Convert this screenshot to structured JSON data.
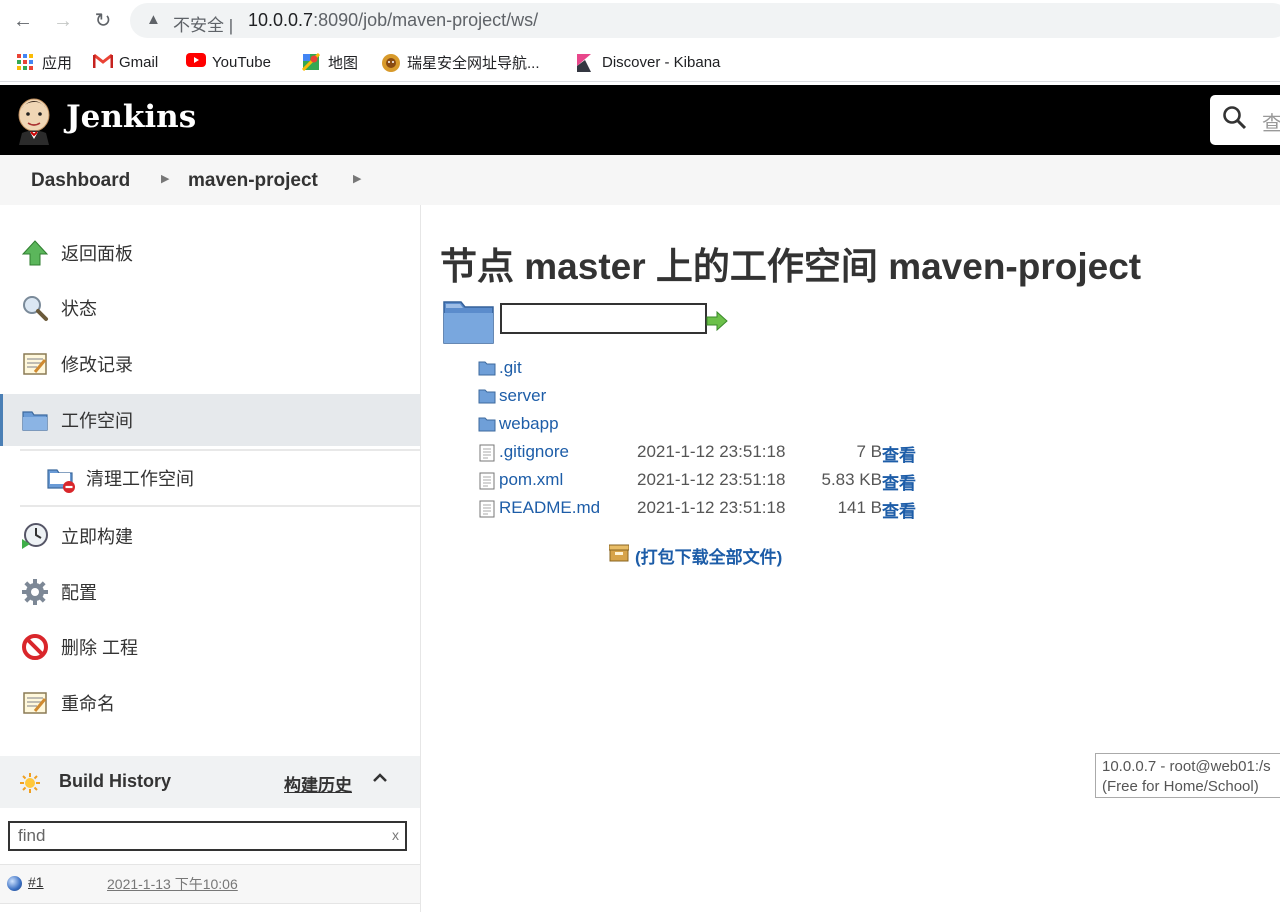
{
  "browser": {
    "not_secure": "不安全 |",
    "url_host": "10.0.0.7",
    "url_path": ":8090/job/maven-project/ws/"
  },
  "bookmarks": [
    {
      "label": "应用",
      "icon": "apps-grid-icon"
    },
    {
      "label": "Gmail",
      "icon": "gmail-icon"
    },
    {
      "label": "YouTube",
      "icon": "youtube-icon"
    },
    {
      "label": "地图",
      "icon": "maps-icon"
    },
    {
      "label": "瑞星安全网址导航...",
      "icon": "rising-lion-icon"
    },
    {
      "label": "Discover - Kibana",
      "icon": "kibana-icon"
    }
  ],
  "header": {
    "title": "Jenkins",
    "search_hint": "查"
  },
  "breadcrumb": {
    "items": [
      "Dashboard",
      "maven-project"
    ]
  },
  "sidebar": {
    "tasks": [
      {
        "label": "返回面板",
        "icon": "up-arrow-icon"
      },
      {
        "label": "状态",
        "icon": "search-icon"
      },
      {
        "label": "修改记录",
        "icon": "notepad-icon"
      },
      {
        "label": "工作空间",
        "icon": "folder-icon"
      },
      {
        "label": "清理工作空间",
        "icon": "folder-delete-icon"
      },
      {
        "label": "立即构建",
        "icon": "clock-icon"
      },
      {
        "label": "配置",
        "icon": "gear-icon"
      },
      {
        "label": "删除 工程",
        "icon": "no-entry-icon"
      },
      {
        "label": "重命名",
        "icon": "notepad-icon"
      }
    ],
    "build_history": {
      "title": "Build History",
      "trend": "构建历史",
      "find_value": "find",
      "find_clear": "x",
      "builds": [
        {
          "number": "#1",
          "date": "2021-1-13 下午10:06"
        }
      ]
    }
  },
  "main": {
    "title": "节点 master 上的工作空间 maven-project",
    "path_value": "",
    "files": [
      {
        "name": ".git",
        "type": "folder",
        "date": "",
        "size": "",
        "view": ""
      },
      {
        "name": "server",
        "type": "folder",
        "date": "",
        "size": "",
        "view": ""
      },
      {
        "name": "webapp",
        "type": "folder",
        "date": "",
        "size": "",
        "view": ""
      },
      {
        "name": ".gitignore",
        "type": "file",
        "date": "2021-1-12 23:51:18",
        "size": "7 B",
        "view": "查看"
      },
      {
        "name": "pom.xml",
        "type": "file",
        "date": "2021-1-12 23:51:18",
        "size": "5.83 KB",
        "view": "查看"
      },
      {
        "name": "README.md",
        "type": "file",
        "date": "2021-1-12 23:51:18",
        "size": "141 B",
        "view": "查看"
      }
    ],
    "zip_label": "(打包下载全部文件)"
  },
  "tooltip": {
    "line1": "10.0.0.7 - root@web01:/s",
    "line2": "(Free for Home/School)"
  },
  "colors": {
    "link": "#1d5da8",
    "header_bg": "#000000",
    "active_task_bg": "#e6e9ec"
  }
}
